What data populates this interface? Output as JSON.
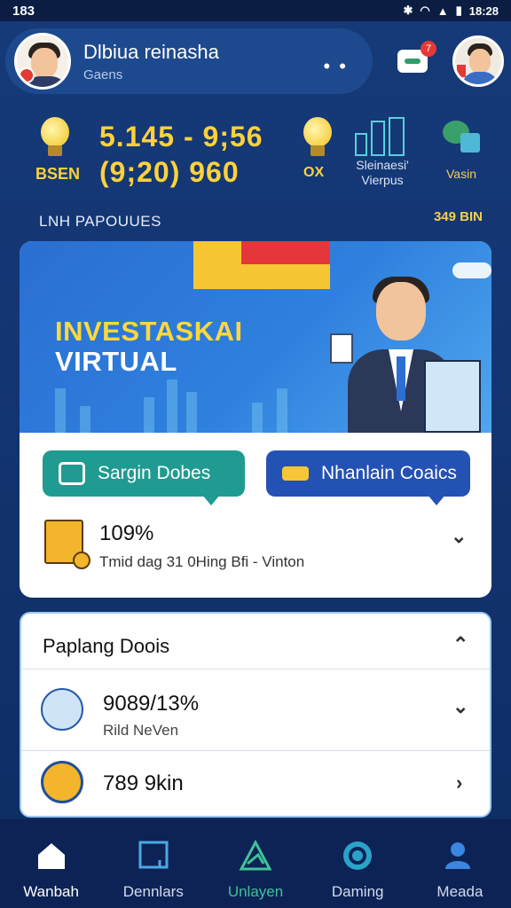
{
  "status_bar": {
    "time": "183",
    "clock": "18:28"
  },
  "header": {
    "user_name": "Dlbiua reinasha",
    "user_sub": "Gaens",
    "menu_dots": "• •",
    "notification_count": "7"
  },
  "stats": {
    "left_label": "BSEN",
    "value_top": "5.145 -  9;56",
    "value_bottom": "(9;20)   960",
    "mid_label": "OX",
    "city_label": "Sleinaesi' Vierpus",
    "right_label": "Vasin"
  },
  "section": {
    "title": "LNH PAPOUUES",
    "right_value": "349 BIN"
  },
  "banner": {
    "title_line1": "INVESTASKAI",
    "title_line2": "VIRTUAL"
  },
  "actions": {
    "primary_label": "Sargin Dobes",
    "secondary_label": "Nhanlain Coaics"
  },
  "summary": {
    "percent": "109%",
    "subtitle": "Tmid dag 31 0Hing Bfi - Vinton"
  },
  "popular": {
    "title": "Paplang Doois",
    "items": [
      {
        "value": "9089/13%",
        "sub": "Rild NeVen"
      },
      {
        "value": "789 9kin",
        "sub": ""
      }
    ]
  },
  "nav": {
    "items": [
      {
        "label": "Wanbah",
        "color": "#ffffff"
      },
      {
        "label": "Dennlars",
        "color": "#d0dcf0"
      },
      {
        "label": "Unlayen",
        "color": "#3fc39a"
      },
      {
        "label": "Daming",
        "color": "#d0dcf0"
      },
      {
        "label": "Meada",
        "color": "#d0dcf0"
      }
    ]
  },
  "colors": {
    "accent_yellow": "#ffd23a",
    "primary_green": "#1f9b91",
    "primary_blue": "#2451b4",
    "background": "#133572"
  }
}
